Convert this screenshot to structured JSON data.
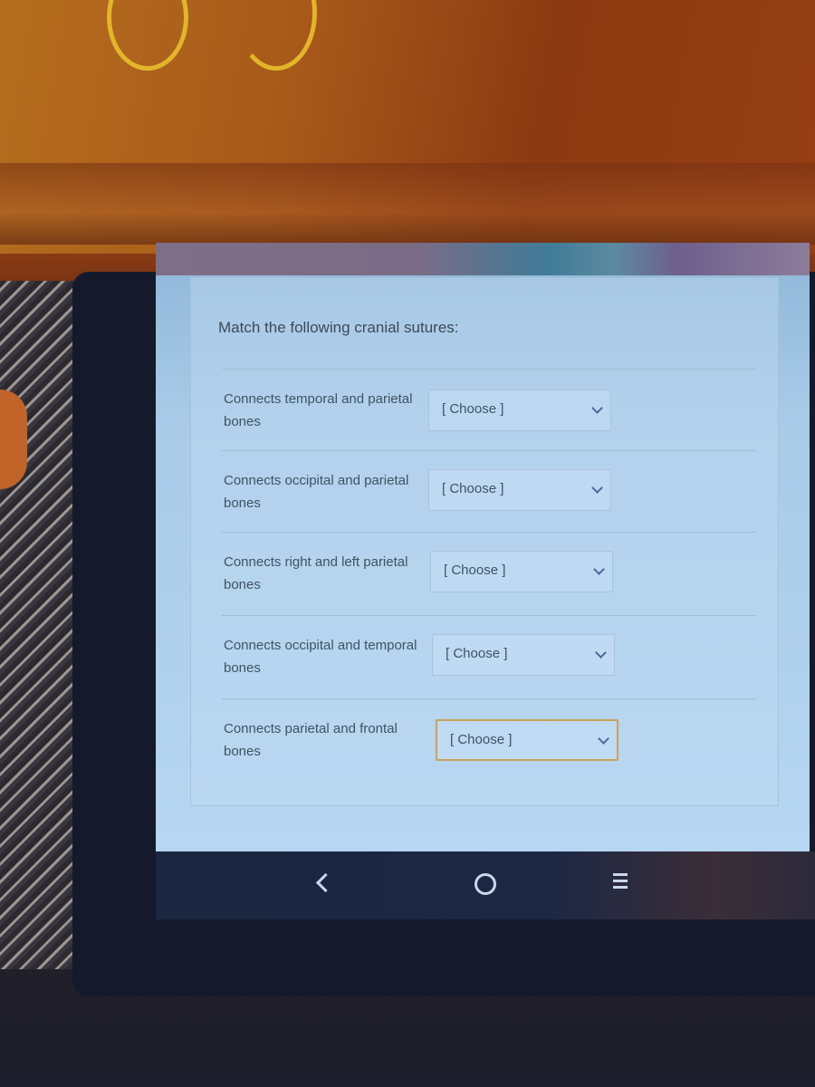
{
  "quiz": {
    "title": "Match the following cranial sutures:",
    "rows": [
      {
        "label": "Connects temporal and parietal bones",
        "selected": "[ Choose ]"
      },
      {
        "label": "Connects occipital and parietal bones",
        "selected": "[ Choose ]"
      },
      {
        "label": "Connects right and left parietal bones",
        "selected": "[ Choose ]"
      },
      {
        "label": "Connects occipital and temporal bones",
        "selected": "[ Choose ]"
      },
      {
        "label": "Connects parietal and frontal bones",
        "selected": "[ Choose ]"
      }
    ],
    "focused_index": 4
  },
  "navbar": {
    "icons": [
      "back-icon",
      "home-icon",
      "recent-apps-icon"
    ]
  },
  "colors": {
    "focus_border": "#c9a25a",
    "text": "#3f5364",
    "screen_bg": "#b6d6f2"
  }
}
